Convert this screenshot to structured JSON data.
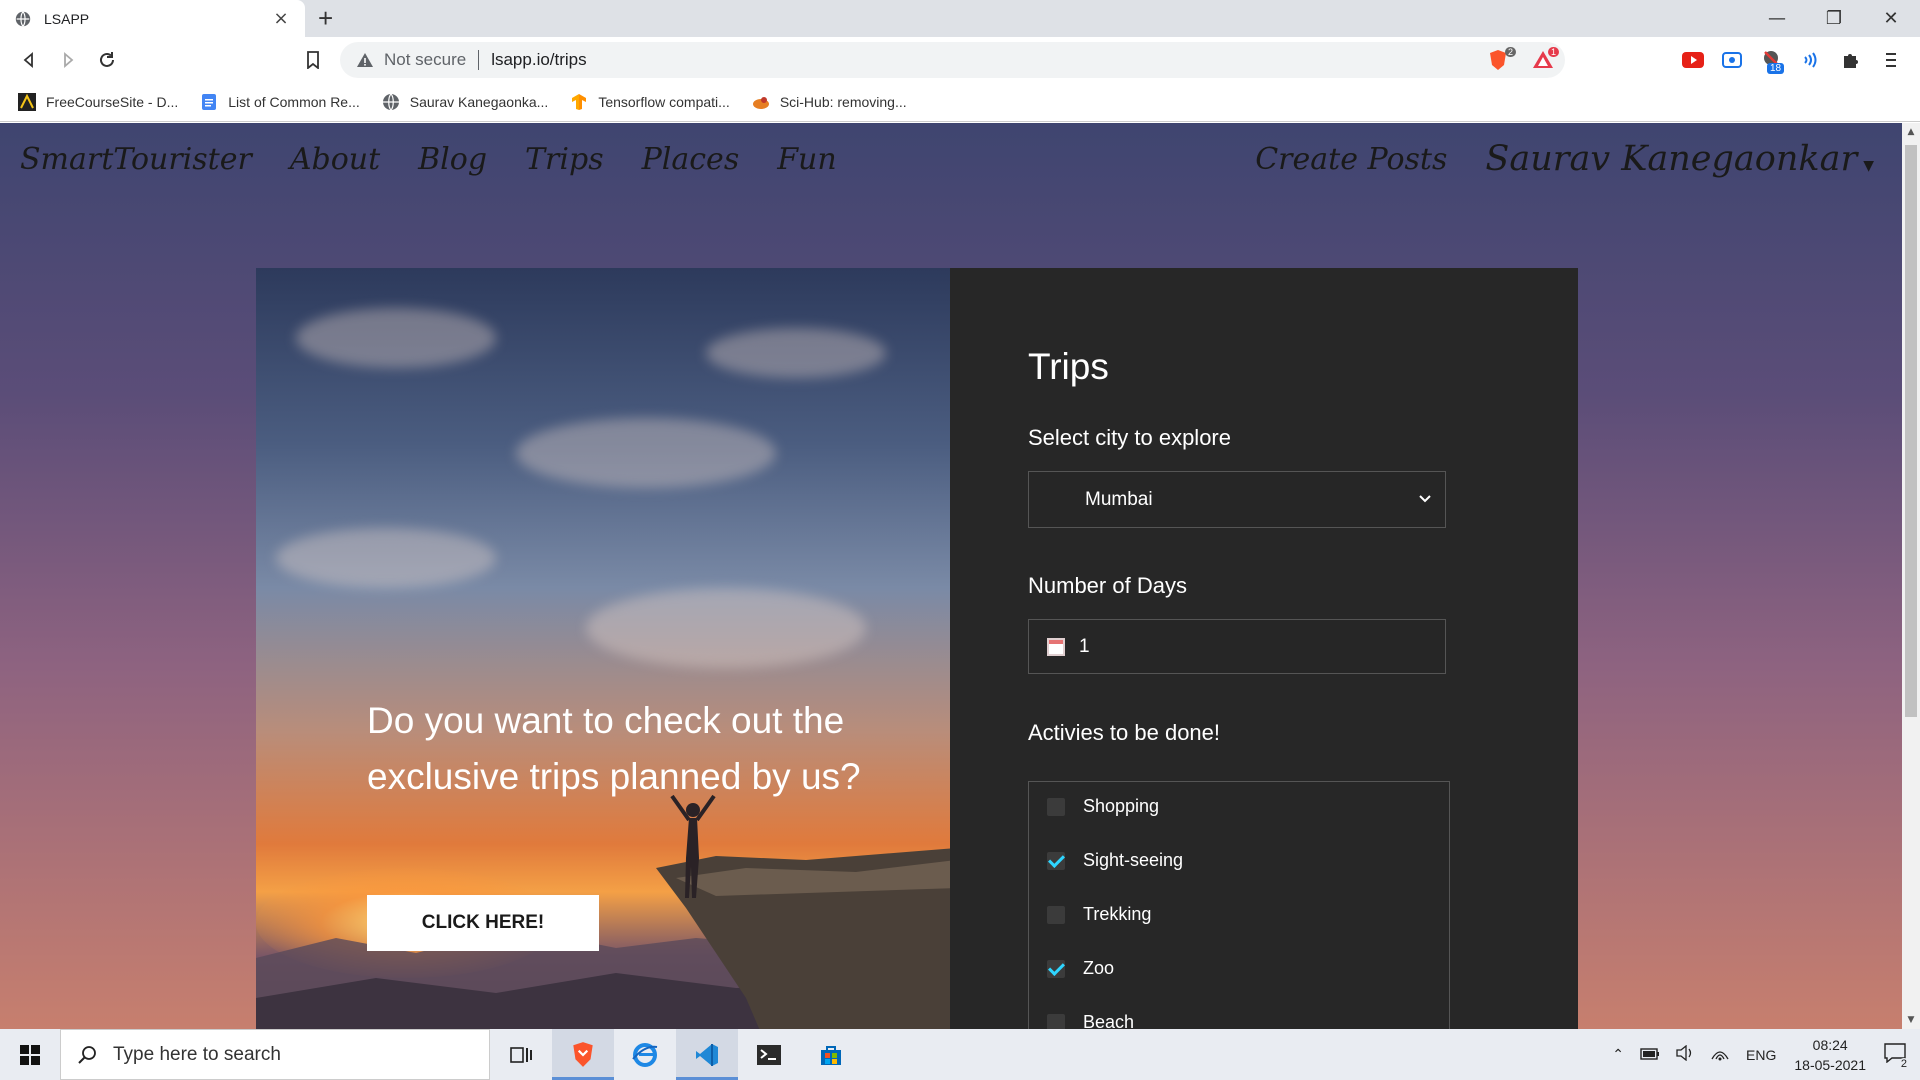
{
  "browser": {
    "tab_title": "LSAPP",
    "tab_close": "×",
    "new_tab": "+",
    "not_secure": "Not secure",
    "url": "lsapp.io/trips",
    "brave_badge": "2",
    "alert_badge": "1",
    "ext_badge": "18",
    "bookmarks": [
      {
        "label": "FreeCourseSite - D...",
        "icon": "freecoursesite-icon"
      },
      {
        "label": "List of Common Re...",
        "icon": "docs-icon"
      },
      {
        "label": "Saurav Kanegaonka...",
        "icon": "globe-icon"
      },
      {
        "label": "Tensorflow compati...",
        "icon": "tensorflow-icon"
      },
      {
        "label": "Sci-Hub: removing...",
        "icon": "scihub-icon"
      }
    ]
  },
  "site": {
    "brand": "SmartTourister",
    "nav": [
      "About",
      "Blog",
      "Trips",
      "Places",
      "Fun"
    ],
    "create_posts": "Create Posts",
    "user": "Saurav Kanegaonkar"
  },
  "hero": {
    "text": "Do you want to check out the exclusive trips planned by us?",
    "button": "CLICK HERE!"
  },
  "form": {
    "title": "Trips",
    "city_label": "Select city to explore",
    "city_value": "Mumbai",
    "days_label": "Number of Days",
    "days_value": "1",
    "activities_label": "Activies to be done!",
    "activities": [
      {
        "label": "Shopping",
        "checked": false
      },
      {
        "label": "Sight-seeing",
        "checked": true
      },
      {
        "label": "Trekking",
        "checked": false
      },
      {
        "label": "Zoo",
        "checked": true
      },
      {
        "label": "Beach",
        "checked": false
      }
    ]
  },
  "taskbar": {
    "search_placeholder": "Type here to search",
    "language": "ENG",
    "time": "08:24",
    "date": "18-05-2021",
    "notifications": "2"
  },
  "colors": {
    "panel_bg": "#272727",
    "checkbox_tick": "#2ed5ff",
    "accent_blue": "#5b8fd6"
  }
}
